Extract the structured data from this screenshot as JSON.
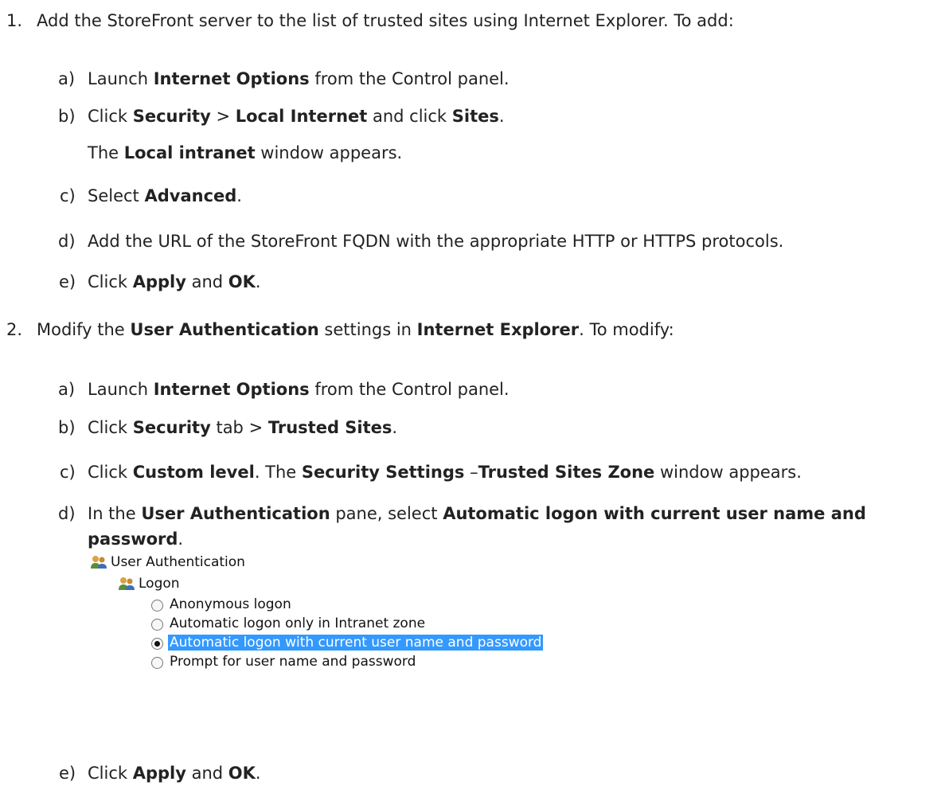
{
  "step1": {
    "num": "1.",
    "text": "Add the StoreFront server to the list of trusted sites using Internet Explorer. To add:",
    "a": {
      "lbl": "a)",
      "t1": "Launch ",
      "b1": "Internet Options",
      "t2": " from the Control panel."
    },
    "b": {
      "lbl": "b)",
      "t1": "Click ",
      "b1": "Security",
      "t2": " > ",
      "b2": "Local Internet",
      "t3": " and click ",
      "b3": "Sites",
      "t4": "."
    },
    "b_note": {
      "t1": "The ",
      "b1": "Local intranet",
      "t2": " window appears."
    },
    "c": {
      "lbl": "c)",
      "t1": "Select ",
      "b1": "Advanced",
      "t2": "."
    },
    "d": {
      "lbl": "d)",
      "t1": "Add the URL of the StoreFront FQDN with the appropriate HTTP or HTTPS protocols."
    },
    "e": {
      "lbl": "e)",
      "t1": "Click ",
      "b1": "Apply",
      "t2": " and ",
      "b2": "OK",
      "t3": "."
    }
  },
  "step2": {
    "num": "2.",
    "t1": "Modify the ",
    "b1": "User Authentication",
    "t2": " settings in ",
    "b2": "Internet Explorer",
    "t3": ". To modify:",
    "a": {
      "lbl": "a)",
      "t1": "Launch ",
      "b1": "Internet Options",
      "t2": " from the Control panel."
    },
    "b": {
      "lbl": "b)",
      "t1": "Click ",
      "b1": "Security",
      "t2": " tab > ",
      "b2": "Trusted Sites",
      "t3": "."
    },
    "c": {
      "lbl": "c)",
      "t1": "Click ",
      "b1": "Custom level",
      "t2": ". The ",
      "b2": "Security Settings",
      "t3": " –",
      "b3": "Trusted Sites Zone",
      "t4": " window appears."
    },
    "d": {
      "lbl": "d)",
      "t1": "In the ",
      "b1": "User Authentication",
      "t2": " pane, select ",
      "b2": "Automatic logon with current user name and",
      "b3": "password",
      "t3": "."
    },
    "e": {
      "lbl": "e)",
      "t1": "Click ",
      "b1": "Apply",
      "t2": " and ",
      "b2": "OK",
      "t3": "."
    }
  },
  "tree": {
    "root": "User Authentication",
    "group": "Logon",
    "options": [
      {
        "label": "Anonymous logon",
        "checked": false
      },
      {
        "label": "Automatic logon only in Intranet zone",
        "checked": false
      },
      {
        "label": "Automatic logon with current user name and password",
        "checked": true
      },
      {
        "label": "Prompt for user name and password",
        "checked": false
      }
    ],
    "icon": "users-icon"
  }
}
